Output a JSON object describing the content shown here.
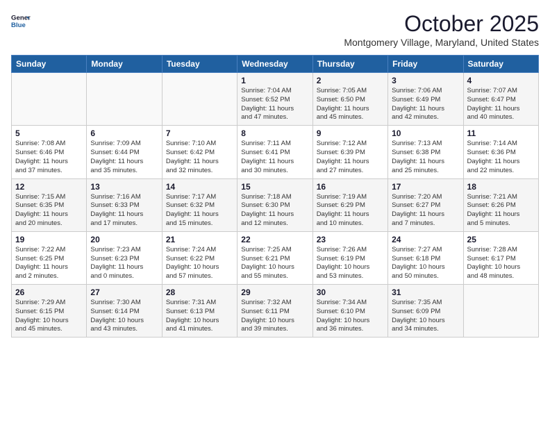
{
  "header": {
    "logo_line1": "General",
    "logo_line2": "Blue",
    "month": "October 2025",
    "location": "Montgomery Village, Maryland, United States"
  },
  "weekdays": [
    "Sunday",
    "Monday",
    "Tuesday",
    "Wednesday",
    "Thursday",
    "Friday",
    "Saturday"
  ],
  "weeks": [
    [
      {
        "day": "",
        "info": ""
      },
      {
        "day": "",
        "info": ""
      },
      {
        "day": "",
        "info": ""
      },
      {
        "day": "1",
        "info": "Sunrise: 7:04 AM\nSunset: 6:52 PM\nDaylight: 11 hours\nand 47 minutes."
      },
      {
        "day": "2",
        "info": "Sunrise: 7:05 AM\nSunset: 6:50 PM\nDaylight: 11 hours\nand 45 minutes."
      },
      {
        "day": "3",
        "info": "Sunrise: 7:06 AM\nSunset: 6:49 PM\nDaylight: 11 hours\nand 42 minutes."
      },
      {
        "day": "4",
        "info": "Sunrise: 7:07 AM\nSunset: 6:47 PM\nDaylight: 11 hours\nand 40 minutes."
      }
    ],
    [
      {
        "day": "5",
        "info": "Sunrise: 7:08 AM\nSunset: 6:46 PM\nDaylight: 11 hours\nand 37 minutes."
      },
      {
        "day": "6",
        "info": "Sunrise: 7:09 AM\nSunset: 6:44 PM\nDaylight: 11 hours\nand 35 minutes."
      },
      {
        "day": "7",
        "info": "Sunrise: 7:10 AM\nSunset: 6:42 PM\nDaylight: 11 hours\nand 32 minutes."
      },
      {
        "day": "8",
        "info": "Sunrise: 7:11 AM\nSunset: 6:41 PM\nDaylight: 11 hours\nand 30 minutes."
      },
      {
        "day": "9",
        "info": "Sunrise: 7:12 AM\nSunset: 6:39 PM\nDaylight: 11 hours\nand 27 minutes."
      },
      {
        "day": "10",
        "info": "Sunrise: 7:13 AM\nSunset: 6:38 PM\nDaylight: 11 hours\nand 25 minutes."
      },
      {
        "day": "11",
        "info": "Sunrise: 7:14 AM\nSunset: 6:36 PM\nDaylight: 11 hours\nand 22 minutes."
      }
    ],
    [
      {
        "day": "12",
        "info": "Sunrise: 7:15 AM\nSunset: 6:35 PM\nDaylight: 11 hours\nand 20 minutes."
      },
      {
        "day": "13",
        "info": "Sunrise: 7:16 AM\nSunset: 6:33 PM\nDaylight: 11 hours\nand 17 minutes."
      },
      {
        "day": "14",
        "info": "Sunrise: 7:17 AM\nSunset: 6:32 PM\nDaylight: 11 hours\nand 15 minutes."
      },
      {
        "day": "15",
        "info": "Sunrise: 7:18 AM\nSunset: 6:30 PM\nDaylight: 11 hours\nand 12 minutes."
      },
      {
        "day": "16",
        "info": "Sunrise: 7:19 AM\nSunset: 6:29 PM\nDaylight: 11 hours\nand 10 minutes."
      },
      {
        "day": "17",
        "info": "Sunrise: 7:20 AM\nSunset: 6:27 PM\nDaylight: 11 hours\nand 7 minutes."
      },
      {
        "day": "18",
        "info": "Sunrise: 7:21 AM\nSunset: 6:26 PM\nDaylight: 11 hours\nand 5 minutes."
      }
    ],
    [
      {
        "day": "19",
        "info": "Sunrise: 7:22 AM\nSunset: 6:25 PM\nDaylight: 11 hours\nand 2 minutes."
      },
      {
        "day": "20",
        "info": "Sunrise: 7:23 AM\nSunset: 6:23 PM\nDaylight: 11 hours\nand 0 minutes."
      },
      {
        "day": "21",
        "info": "Sunrise: 7:24 AM\nSunset: 6:22 PM\nDaylight: 10 hours\nand 57 minutes."
      },
      {
        "day": "22",
        "info": "Sunrise: 7:25 AM\nSunset: 6:21 PM\nDaylight: 10 hours\nand 55 minutes."
      },
      {
        "day": "23",
        "info": "Sunrise: 7:26 AM\nSunset: 6:19 PM\nDaylight: 10 hours\nand 53 minutes."
      },
      {
        "day": "24",
        "info": "Sunrise: 7:27 AM\nSunset: 6:18 PM\nDaylight: 10 hours\nand 50 minutes."
      },
      {
        "day": "25",
        "info": "Sunrise: 7:28 AM\nSunset: 6:17 PM\nDaylight: 10 hours\nand 48 minutes."
      }
    ],
    [
      {
        "day": "26",
        "info": "Sunrise: 7:29 AM\nSunset: 6:15 PM\nDaylight: 10 hours\nand 45 minutes."
      },
      {
        "day": "27",
        "info": "Sunrise: 7:30 AM\nSunset: 6:14 PM\nDaylight: 10 hours\nand 43 minutes."
      },
      {
        "day": "28",
        "info": "Sunrise: 7:31 AM\nSunset: 6:13 PM\nDaylight: 10 hours\nand 41 minutes."
      },
      {
        "day": "29",
        "info": "Sunrise: 7:32 AM\nSunset: 6:11 PM\nDaylight: 10 hours\nand 39 minutes."
      },
      {
        "day": "30",
        "info": "Sunrise: 7:34 AM\nSunset: 6:10 PM\nDaylight: 10 hours\nand 36 minutes."
      },
      {
        "day": "31",
        "info": "Sunrise: 7:35 AM\nSunset: 6:09 PM\nDaylight: 10 hours\nand 34 minutes."
      },
      {
        "day": "",
        "info": ""
      }
    ]
  ]
}
